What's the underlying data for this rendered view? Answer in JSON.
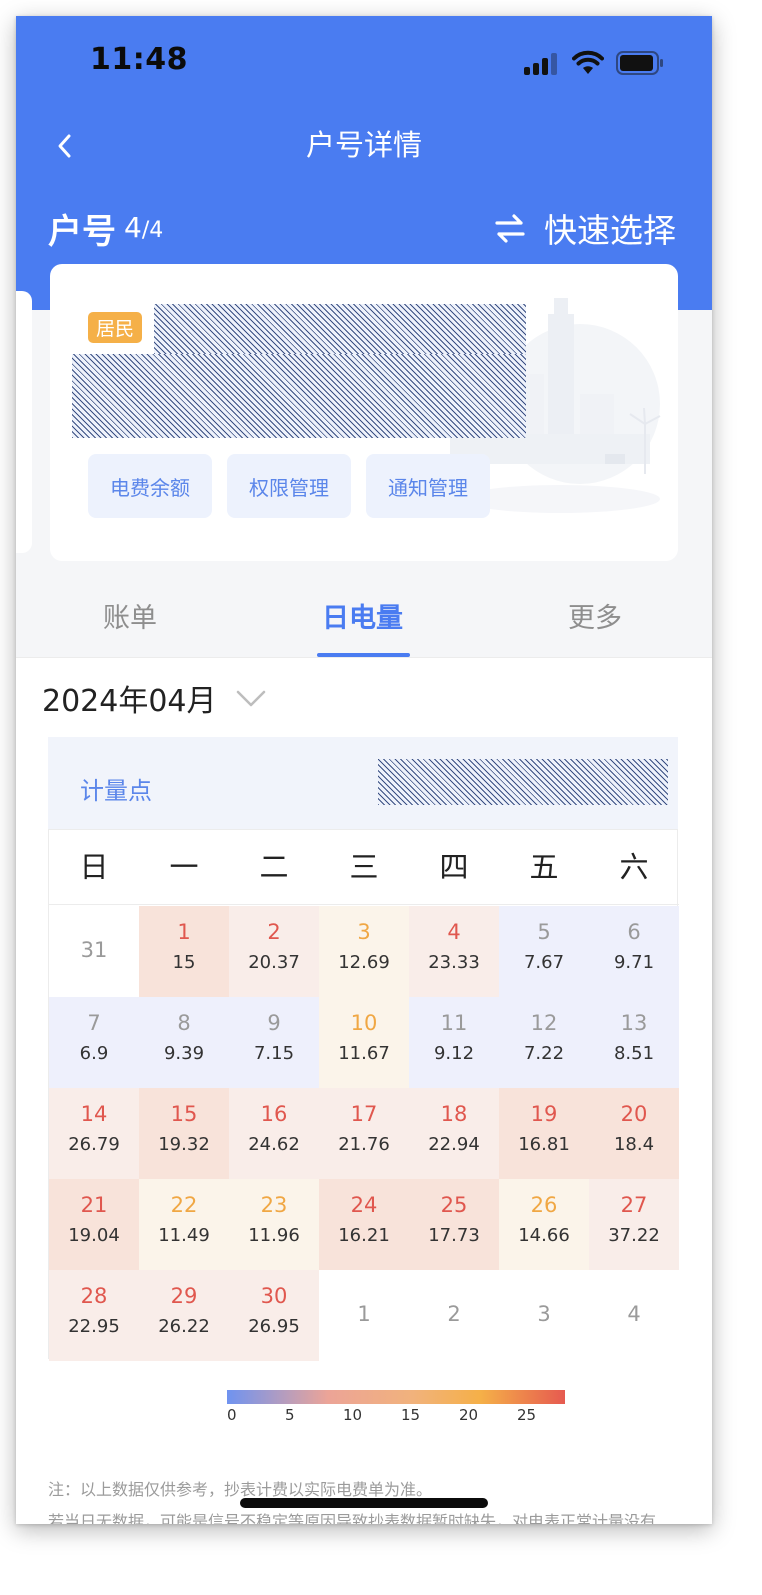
{
  "status_bar": {
    "time": "11:48"
  },
  "nav": {
    "title": "户号详情"
  },
  "account": {
    "label": "户号",
    "current": "4",
    "total": "/4",
    "quick_select": "快速选择"
  },
  "card": {
    "badge": "居民",
    "buttons": [
      "电费余额",
      "权限管理",
      "通知管理"
    ]
  },
  "tabs": [
    {
      "label": "账单",
      "active": false
    },
    {
      "label": "日电量",
      "active": true
    },
    {
      "label": "更多",
      "active": false
    }
  ],
  "month": "2024年04月",
  "meter": {
    "label": "计量点"
  },
  "colors": {
    "primary": "#4a7cf1",
    "badge": "#f5b048",
    "cell_low": "#eef0fc",
    "cell_mid_low": "#fbf4ea",
    "cell_mid": "#f9ede9",
    "cell_high": "#f8e3da",
    "num_low": "#9a9a9a",
    "num_mid": "#f0a744",
    "num_high": "#e0574e"
  },
  "calendar": {
    "weekdays": [
      "日",
      "一",
      "二",
      "三",
      "四",
      "五",
      "六"
    ],
    "days": [
      {
        "day": "31",
        "value": "",
        "tone": "out"
      },
      {
        "day": "1",
        "value": "15",
        "tone": "high"
      },
      {
        "day": "2",
        "value": "20.37",
        "tone": "red"
      },
      {
        "day": "3",
        "value": "12.69",
        "tone": "midlow"
      },
      {
        "day": "4",
        "value": "23.33",
        "tone": "red"
      },
      {
        "day": "5",
        "value": "7.67",
        "tone": "low"
      },
      {
        "day": "6",
        "value": "9.71",
        "tone": "low"
      },
      {
        "day": "7",
        "value": "6.9",
        "tone": "low"
      },
      {
        "day": "8",
        "value": "9.39",
        "tone": "low"
      },
      {
        "day": "9",
        "value": "7.15",
        "tone": "low"
      },
      {
        "day": "10",
        "value": "11.67",
        "tone": "midlow"
      },
      {
        "day": "11",
        "value": "9.12",
        "tone": "low"
      },
      {
        "day": "12",
        "value": "7.22",
        "tone": "low"
      },
      {
        "day": "13",
        "value": "8.51",
        "tone": "low"
      },
      {
        "day": "14",
        "value": "26.79",
        "tone": "red"
      },
      {
        "day": "15",
        "value": "19.32",
        "tone": "high"
      },
      {
        "day": "16",
        "value": "24.62",
        "tone": "red"
      },
      {
        "day": "17",
        "value": "21.76",
        "tone": "red"
      },
      {
        "day": "18",
        "value": "22.94",
        "tone": "red"
      },
      {
        "day": "19",
        "value": "16.81",
        "tone": "high"
      },
      {
        "day": "20",
        "value": "18.4",
        "tone": "high"
      },
      {
        "day": "21",
        "value": "19.04",
        "tone": "high"
      },
      {
        "day": "22",
        "value": "11.49",
        "tone": "midlow"
      },
      {
        "day": "23",
        "value": "11.96",
        "tone": "midlow"
      },
      {
        "day": "24",
        "value": "16.21",
        "tone": "high"
      },
      {
        "day": "25",
        "value": "17.73",
        "tone": "high"
      },
      {
        "day": "26",
        "value": "14.66",
        "tone": "midlow"
      },
      {
        "day": "27",
        "value": "37.22",
        "tone": "red"
      },
      {
        "day": "28",
        "value": "22.95",
        "tone": "red"
      },
      {
        "day": "29",
        "value": "26.22",
        "tone": "red"
      },
      {
        "day": "30",
        "value": "26.95",
        "tone": "red"
      },
      {
        "day": "1",
        "value": "",
        "tone": "out"
      },
      {
        "day": "2",
        "value": "",
        "tone": "out"
      },
      {
        "day": "3",
        "value": "",
        "tone": "out"
      },
      {
        "day": "4",
        "value": "",
        "tone": "out"
      }
    ]
  },
  "legend": {
    "ticks": [
      "0",
      "5",
      "10",
      "15",
      "20",
      "25"
    ]
  },
  "notes": {
    "line1": "注：以上数据仅供参考，抄表计费以实际电费单为准。",
    "line2": "若当日无数据，可能是信号不稳定等原因导致抄表数据暂时缺失，对电表正常计量没有"
  }
}
